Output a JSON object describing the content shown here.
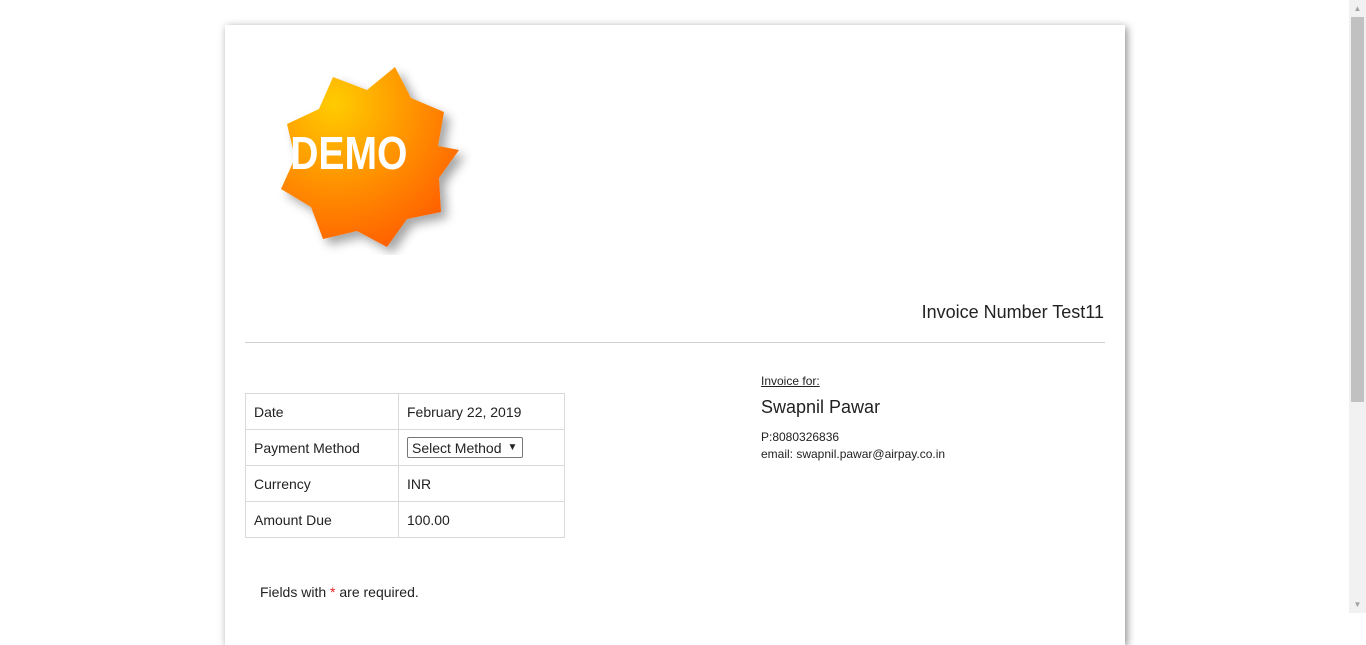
{
  "logo": {
    "text": "DEMO",
    "icon": "demo-starburst-badge",
    "colors": [
      "#ffcc00",
      "#ff8c00",
      "#ff5a00"
    ]
  },
  "invoice": {
    "number_text": "Invoice Number Test11"
  },
  "details": {
    "rows": [
      {
        "label": "Date",
        "value": "February 22, 2019"
      },
      {
        "label": "Payment Method",
        "value": "Select Method"
      },
      {
        "label": "Currency",
        "value": "INR"
      },
      {
        "label": "Amount Due",
        "value": "100.00"
      }
    ]
  },
  "bill_to": {
    "heading": "Invoice for:",
    "name": "Swapnil Pawar",
    "phone": "P:8080326836",
    "email": "email: swapnil.pawar@airpay.co.in"
  },
  "required_note": {
    "prefix": "Fields with ",
    "asterisk": "*",
    "suffix": " are required."
  },
  "colors": {
    "asterisk": "#e02020",
    "divider": "#cfcfcf",
    "table_border": "#d9d9d9"
  }
}
